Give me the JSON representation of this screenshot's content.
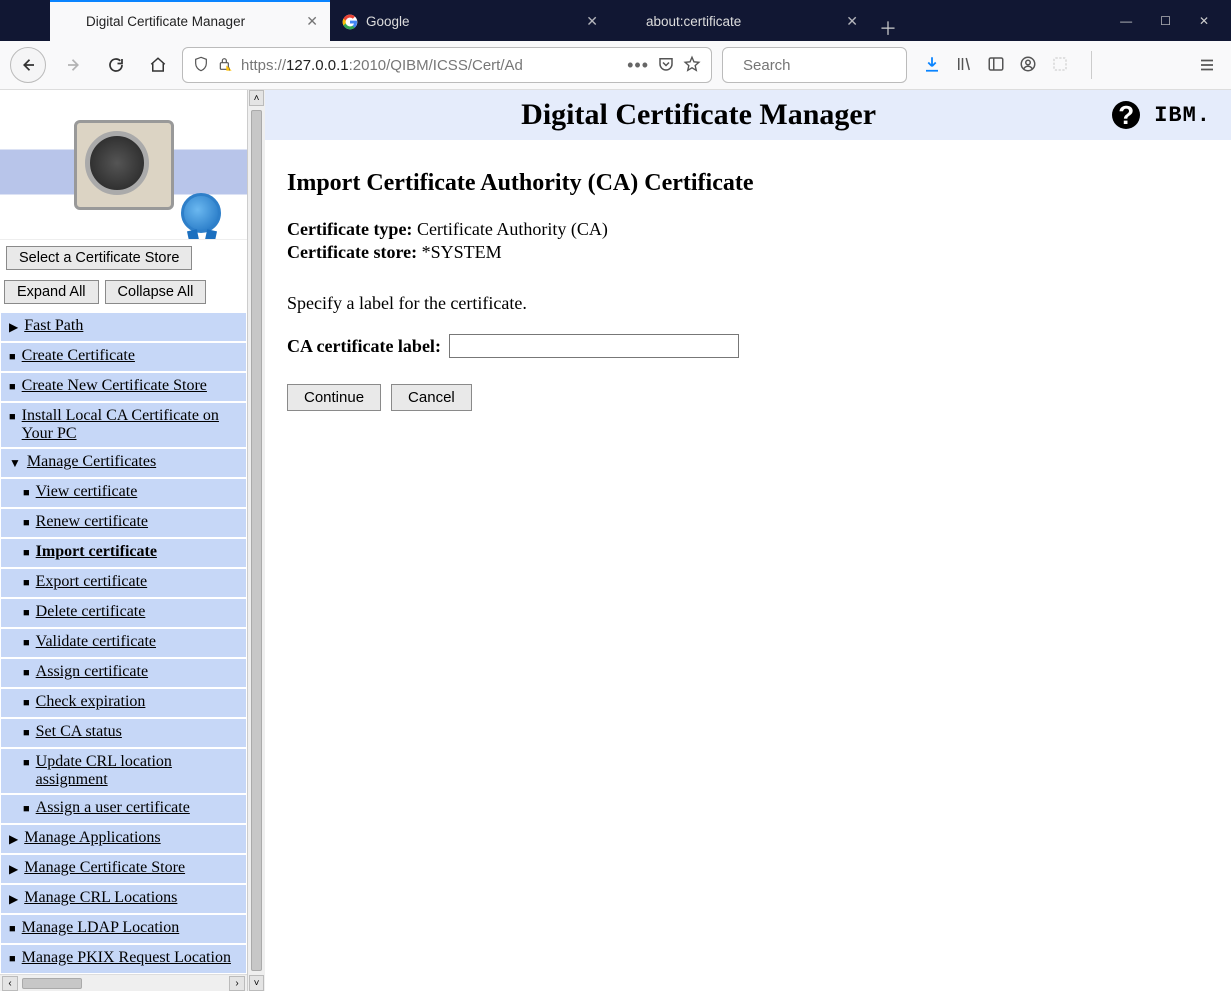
{
  "browser": {
    "tabs": [
      {
        "label": "Digital Certificate Manager",
        "active": true
      },
      {
        "label": "Google",
        "active": false
      },
      {
        "label": "about:certificate",
        "active": false
      }
    ],
    "url_display_prefix": "https://",
    "url_display_host": "127.0.0.1",
    "url_display_port": ":2010",
    "url_display_path": "/QIBM/ICSS/Cert/Ad",
    "search_placeholder": "Search"
  },
  "banner": {
    "title": "Digital Certificate Manager",
    "ibm_logo_text": "IBM.",
    "help_glyph": "?"
  },
  "sidebar": {
    "select_store_btn": "Select a Certificate Store",
    "expand_btn": "Expand All",
    "collapse_btn": "Collapse All",
    "top_items": [
      {
        "label": "Fast Path",
        "type": "arrow"
      },
      {
        "label": "Create Certificate",
        "type": "square"
      },
      {
        "label": "Create New Certificate Store",
        "type": "square"
      },
      {
        "label": "Install Local CA Certificate on Your PC",
        "type": "square"
      },
      {
        "label": "Manage Certificates",
        "type": "arrow-down"
      }
    ],
    "manage_cert_children": [
      {
        "label": "View certificate"
      },
      {
        "label": "Renew certificate"
      },
      {
        "label": "Import certificate",
        "current": true
      },
      {
        "label": "Export certificate"
      },
      {
        "label": "Delete certificate"
      },
      {
        "label": "Validate certificate"
      },
      {
        "label": "Assign certificate"
      },
      {
        "label": "Check expiration"
      },
      {
        "label": "Set CA status"
      },
      {
        "label": "Update CRL location assignment"
      },
      {
        "label": "Assign a user certificate"
      }
    ],
    "bottom_items": [
      {
        "label": "Manage Applications",
        "type": "arrow"
      },
      {
        "label": "Manage Certificate Store",
        "type": "arrow"
      },
      {
        "label": "Manage CRL Locations",
        "type": "arrow"
      },
      {
        "label": "Manage LDAP Location",
        "type": "square"
      },
      {
        "label": "Manage PKIX Request Location",
        "type": "square"
      }
    ]
  },
  "page": {
    "heading": "Import Certificate Authority (CA) Certificate",
    "cert_type_label": "Certificate type:",
    "cert_type_value": "Certificate Authority (CA)",
    "cert_store_label": "Certificate store:",
    "cert_store_value": "*SYSTEM",
    "prompt": "Specify a label for the certificate.",
    "field_label": "CA certificate label:",
    "field_value": "",
    "continue_btn": "Continue",
    "cancel_btn": "Cancel"
  }
}
